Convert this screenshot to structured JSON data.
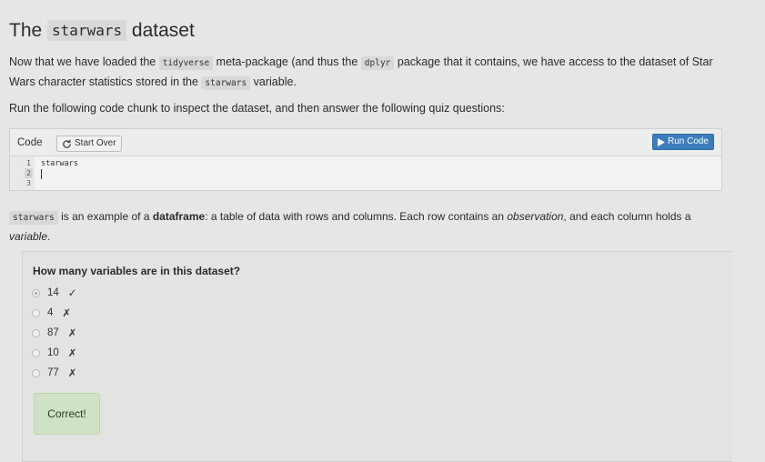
{
  "heading": {
    "prefix": "The ",
    "code": "starwars",
    "suffix": " dataset"
  },
  "intro": {
    "t1": "Now that we have loaded the ",
    "c1": "tidyverse",
    "t2": " meta-package (and thus the ",
    "c2": "dplyr",
    "t3": " package that it contains, we have access to the dataset of Star Wars character statistics stored in the ",
    "c3": "starwars",
    "t4": " variable."
  },
  "instruction": "Run the following code chunk to inspect the dataset, and then answer the following quiz questions:",
  "code_exercise": {
    "label": "Code",
    "start_over": "Start Over",
    "run_code": "Run Code",
    "line_numbers": [
      "1",
      "2",
      "3"
    ],
    "code": "starwars"
  },
  "explanation": {
    "c1": "starwars",
    "t1": " is an example of a ",
    "b1": "dataframe",
    "t2": ": a table of data with rows and columns. Each row contains an ",
    "i1": "observation",
    "t3": ", and each column holds a ",
    "i2": "variable",
    "t4": "."
  },
  "quiz": {
    "question": "How many variables are in this dataset?",
    "options": [
      {
        "label": "14",
        "mark": "✓",
        "selected": true
      },
      {
        "label": "4",
        "mark": "✗",
        "selected": false
      },
      {
        "label": "87",
        "mark": "✗",
        "selected": false
      },
      {
        "label": "10",
        "mark": "✗",
        "selected": false
      },
      {
        "label": "77",
        "mark": "✗",
        "selected": false
      }
    ],
    "feedback": "Correct!"
  }
}
